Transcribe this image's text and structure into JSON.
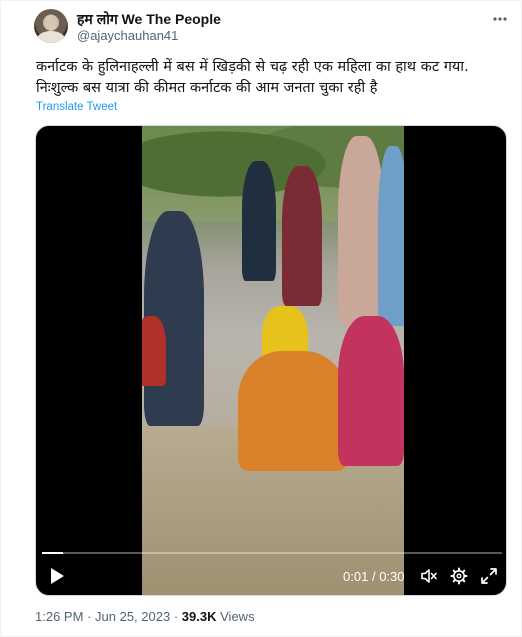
{
  "author": {
    "display_name": "हम लोग We The People",
    "handle": "@ajaychauhan41"
  },
  "tweet": {
    "line1": "कर्नाटक के हुलिनाहल्ली में बस में खिड़की से चढ़ रही एक महिला का हाथ कट गया.",
    "line2": "निःशुल्क बस यात्रा की कीमत कर्नाटक की आम जनता चुका रही है",
    "translate_label": "Translate Tweet"
  },
  "video": {
    "current_time": "0:01",
    "separator": "/",
    "duration": "0:30",
    "progress": 0.045
  },
  "meta": {
    "time": "1:26 PM",
    "dot": "·",
    "date": "Jun 25, 2023",
    "views_count": "39.3K",
    "views_label": "Views"
  },
  "icons": {
    "more": "more-icon",
    "play": "play-icon",
    "volume": "volume-muted-icon",
    "settings": "gear-icon",
    "fullscreen": "fullscreen-icon"
  },
  "colors": {
    "link": "#1d9bf0",
    "secondary_text": "#536471",
    "primary_text": "#0f1419"
  }
}
